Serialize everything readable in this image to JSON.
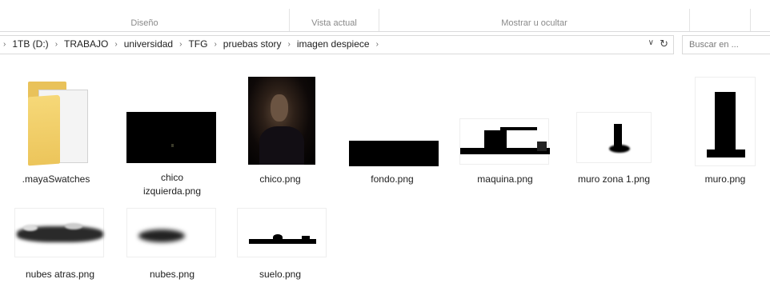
{
  "ribbon": {
    "groups": [
      {
        "label": "Diseño"
      },
      {
        "label": "Vista actual"
      },
      {
        "label": "Mostrar u ocultar"
      }
    ]
  },
  "address": {
    "crumbs": [
      "1TB (D:)",
      "TRABAJO",
      "universidad",
      "TFG",
      "pruebas story",
      "imagen despiece"
    ]
  },
  "search": {
    "placeholder": "Buscar en ..."
  },
  "files": [
    {
      "name": ".mayaSwatches",
      "kind": "folder-icon"
    },
    {
      "name": "chico izquierda.png",
      "line1": "chico",
      "line2": "izquierda.png"
    },
    {
      "name": "chico.png"
    },
    {
      "name": "fondo.png"
    },
    {
      "name": "maquina.png"
    },
    {
      "name": "muro zona 1.png"
    },
    {
      "name": "muro.png"
    },
    {
      "name": "nubes atras.png"
    },
    {
      "name": "nubes.png"
    },
    {
      "name": "suelo.png"
    }
  ],
  "colors": {
    "folder": "#ecc55b",
    "text": "#1e1e1e",
    "border": "#d9d9d9"
  }
}
